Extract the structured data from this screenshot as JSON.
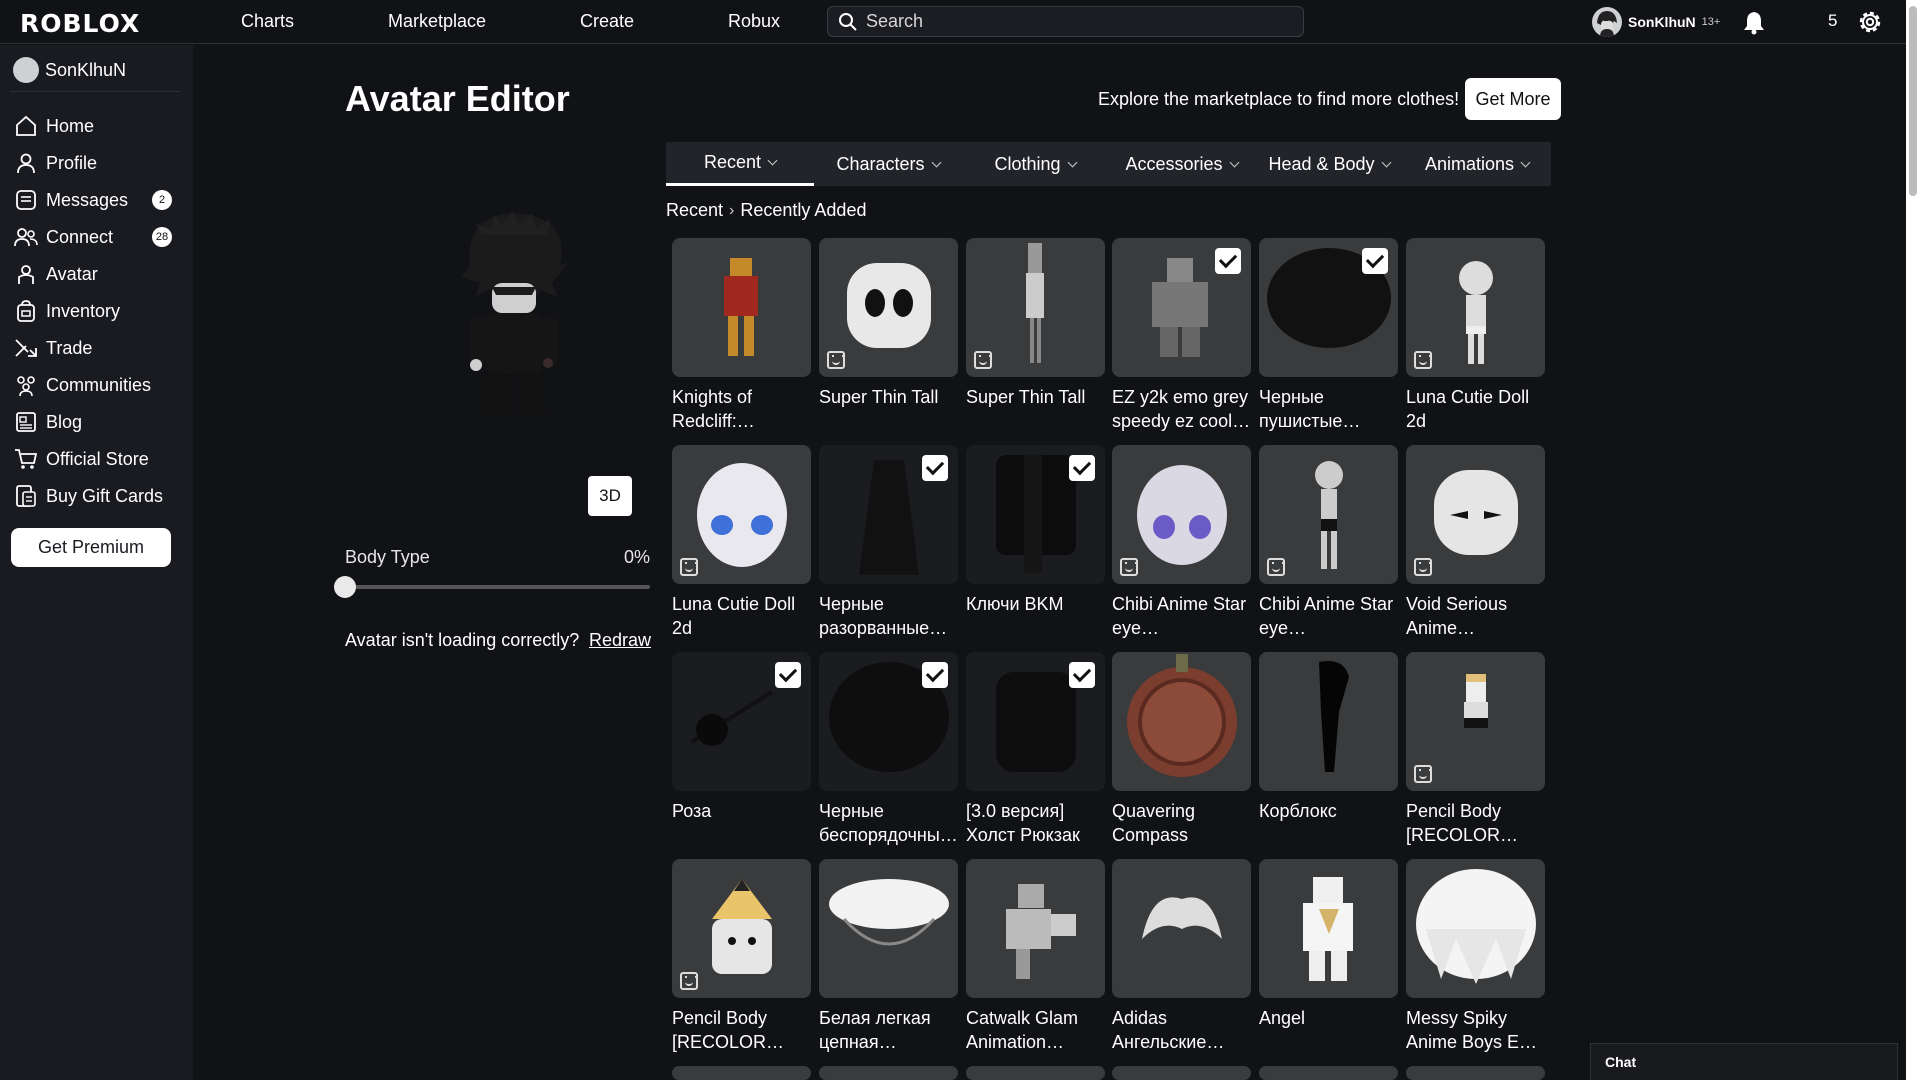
{
  "header": {
    "logo": "ROBLOX",
    "nav": [
      "Charts",
      "Marketplace",
      "Create",
      "Robux"
    ],
    "search_placeholder": "Search",
    "username": "SonKlhuN",
    "age_badge": "13+",
    "robux": "5"
  },
  "sidebar": {
    "username": "SonKlhuN",
    "items": [
      {
        "label": "Home",
        "icon": "home-icon"
      },
      {
        "label": "Profile",
        "icon": "profile-icon"
      },
      {
        "label": "Messages",
        "icon": "messages-icon",
        "badge": "2"
      },
      {
        "label": "Connect",
        "icon": "connect-icon",
        "badge": "28"
      },
      {
        "label": "Avatar",
        "icon": "avatar-icon"
      },
      {
        "label": "Inventory",
        "icon": "inventory-icon"
      },
      {
        "label": "Trade",
        "icon": "trade-icon"
      },
      {
        "label": "Communities",
        "icon": "communities-icon"
      },
      {
        "label": "Blog",
        "icon": "blog-icon"
      },
      {
        "label": "Official Store",
        "icon": "cart-icon"
      },
      {
        "label": "Buy Gift Cards",
        "icon": "gift-card-icon"
      }
    ],
    "premium_button": "Get Premium"
  },
  "main": {
    "title": "Avatar Editor",
    "explore_text": "Explore the marketplace to find more clothes!",
    "get_more": "Get More",
    "view_mode": "3D",
    "body_type_label": "Body Type",
    "body_type_value": "0%",
    "loading_text": "Avatar isn't loading correctly?",
    "redraw": "Redraw",
    "tabs": [
      "Recent",
      "Characters",
      "Clothing",
      "Accessories",
      "Head & Body",
      "Animations"
    ],
    "active_tab": "Recent",
    "breadcrumb": [
      "Recent",
      "Recently Added"
    ],
    "items": [
      {
        "name": "Knights of Redcliff:…",
        "wearing": false,
        "bundle": false
      },
      {
        "name": "Super Thin Tall",
        "wearing": false,
        "bundle": true
      },
      {
        "name": "Super Thin Tall",
        "wearing": false,
        "bundle": true
      },
      {
        "name": "EZ y2k emo grey speedy ez cool…",
        "wearing": true,
        "bundle": false
      },
      {
        "name": "Черные пушистые…",
        "wearing": true,
        "bundle": false
      },
      {
        "name": "Luna Cutie Doll 2d",
        "wearing": false,
        "bundle": true
      },
      {
        "name": "Luna Cutie Doll 2d",
        "wearing": false,
        "bundle": true
      },
      {
        "name": "Черные разорванные…",
        "wearing": true,
        "bundle": false
      },
      {
        "name": "Ключи BKM",
        "wearing": true,
        "bundle": false
      },
      {
        "name": "Chibi Anime Star eye…",
        "wearing": false,
        "bundle": true
      },
      {
        "name": "Chibi Anime Star eye…",
        "wearing": false,
        "bundle": true
      },
      {
        "name": "Void Serious Anime…",
        "wearing": false,
        "bundle": true
      },
      {
        "name": "Роза",
        "wearing": true,
        "bundle": false
      },
      {
        "name": "Черные беспорядочны…",
        "wearing": true,
        "bundle": false
      },
      {
        "name": "[3.0 версия] Холст Рюкзак",
        "wearing": true,
        "bundle": false
      },
      {
        "name": "Quavering Compass",
        "wearing": false,
        "bundle": false
      },
      {
        "name": "Корблокс",
        "wearing": false,
        "bundle": false
      },
      {
        "name": "Pencil Body [RECOLOR…",
        "wearing": false,
        "bundle": true
      },
      {
        "name": "Pencil Body [RECOLOR…",
        "wearing": false,
        "bundle": true
      },
      {
        "name": "Белая легкая цепная…",
        "wearing": false,
        "bundle": false
      },
      {
        "name": "Catwalk Glam Animation…",
        "wearing": false,
        "bundle": false
      },
      {
        "name": "Adidas Ангельские…",
        "wearing": false,
        "bundle": false
      },
      {
        "name": "Angel",
        "wearing": false,
        "bundle": false
      },
      {
        "name": "Messy Spiky Anime Boys E…",
        "wearing": false,
        "bundle": false
      }
    ]
  },
  "chat_label": "Chat"
}
